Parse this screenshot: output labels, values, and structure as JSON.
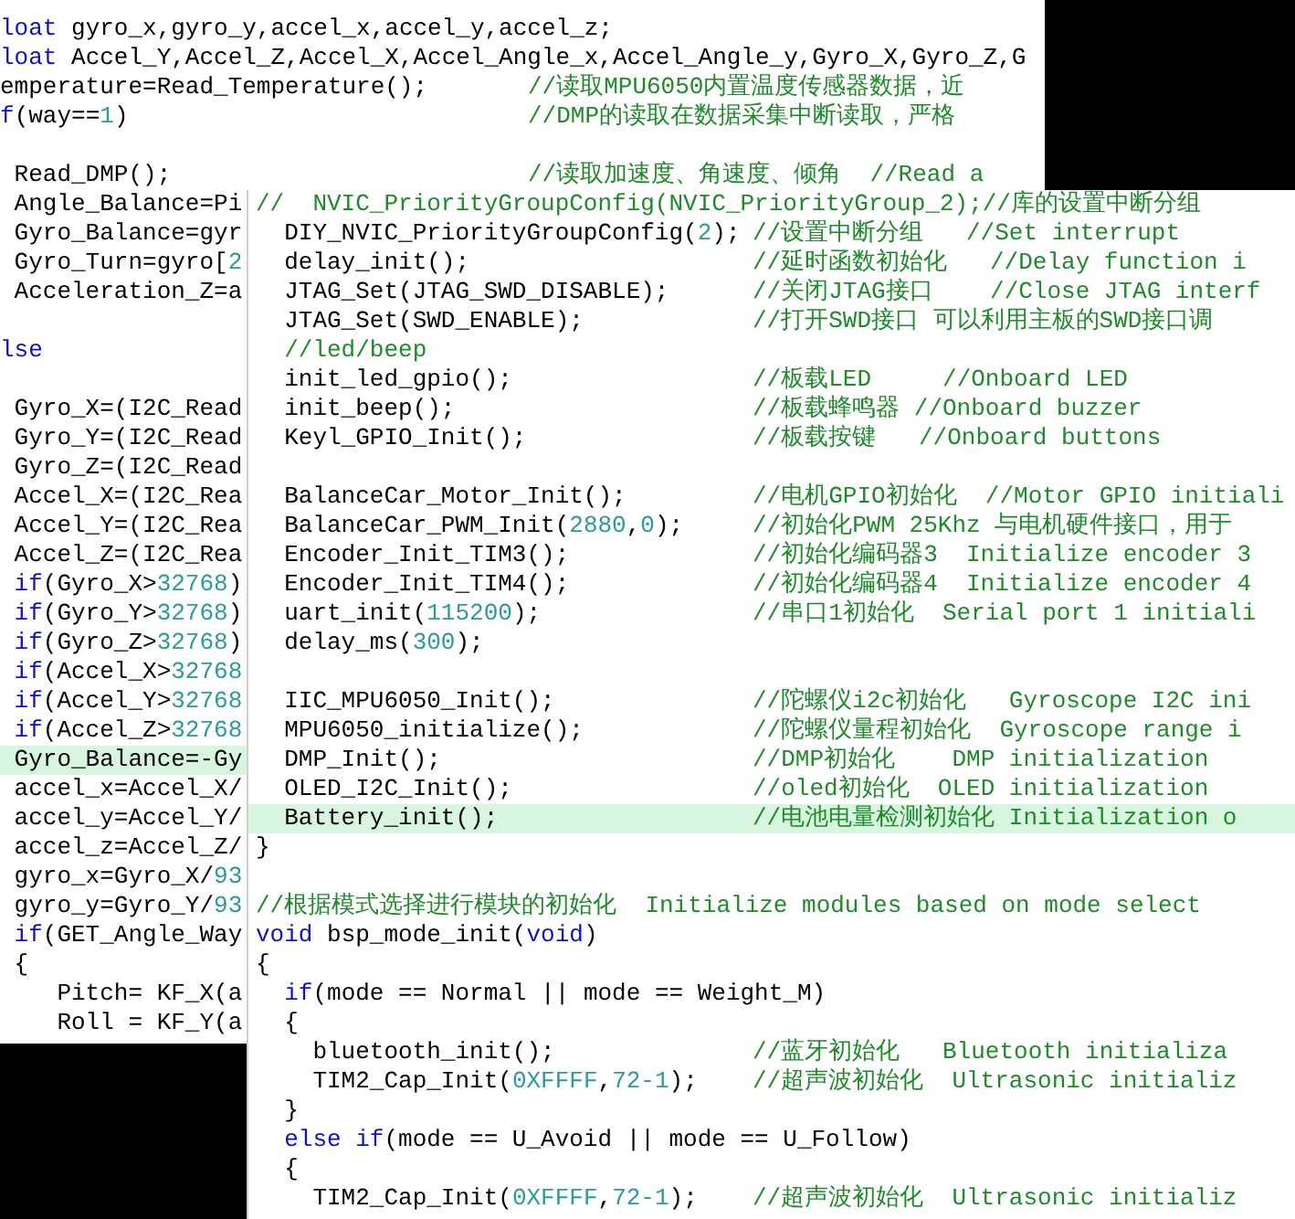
{
  "windows": [
    {
      "kind": "back",
      "lines": [
        {
          "code": [
            {
              "kind": "keyword",
              "text": "loat"
            },
            {
              "kind": "plain",
              "text": " gyro_x,gyro_y,accel_x,accel_y,accel_z;"
            }
          ]
        },
        {
          "code": [
            {
              "kind": "keyword",
              "text": "loat"
            },
            {
              "kind": "plain",
              "text": " Accel_Y,Accel_Z,Accel_X,Accel_Angle_x,Accel_Angle_y,Gyro_X,Gyro_Z,G"
            }
          ]
        },
        {
          "code": [
            {
              "kind": "plain",
              "text": "emperature=Read_Temperature();"
            }
          ],
          "comment": "//读取MPU6050内置温度传感器数据，近"
        },
        {
          "code": [
            {
              "kind": "keyword",
              "text": "f"
            },
            {
              "kind": "plain",
              "text": "(way=="
            },
            {
              "kind": "number",
              "text": "1"
            },
            {
              "kind": "plain",
              "text": ")"
            }
          ],
          "comment": "//DMP的读取在数据采集中断读取，严格"
        },
        {
          "gap_before": true,
          "code": [
            {
              "kind": "plain",
              "text": " Read_DMP();"
            }
          ],
          "comment": "//读取加速度、角速度、倾角  //Read a"
        },
        {
          "code": [
            {
              "kind": "plain",
              "text": " Angle_Balance=Pi"
            }
          ]
        },
        {
          "code": [
            {
              "kind": "plain",
              "text": " Gyro_Balance=gyr"
            }
          ]
        },
        {
          "code": [
            {
              "kind": "plain",
              "text": " Gyro_Turn=gyro["
            },
            {
              "kind": "number",
              "text": "2"
            }
          ]
        },
        {
          "code": [
            {
              "kind": "plain",
              "text": " Acceleration_Z=a"
            }
          ]
        },
        {
          "gap_before": true,
          "code": [
            {
              "kind": "keyword",
              "text": "lse"
            }
          ]
        },
        {
          "gap_before": true,
          "code": [
            {
              "kind": "plain",
              "text": " Gyro_X=(I2C_Read"
            }
          ]
        },
        {
          "code": [
            {
              "kind": "plain",
              "text": " Gyro_Y=(I2C_Read"
            }
          ]
        },
        {
          "code": [
            {
              "kind": "plain",
              "text": " Gyro_Z=(I2C_Read"
            }
          ]
        },
        {
          "code": [
            {
              "kind": "plain",
              "text": " Accel_X=(I2C_Rea"
            }
          ]
        },
        {
          "code": [
            {
              "kind": "plain",
              "text": " Accel_Y=(I2C_Rea"
            }
          ]
        },
        {
          "code": [
            {
              "kind": "plain",
              "text": " Accel_Z=(I2C_Rea"
            }
          ]
        },
        {
          "code": [
            {
              "kind": "keyword",
              "text": " if"
            },
            {
              "kind": "plain",
              "text": "(Gyro_X>"
            },
            {
              "kind": "number",
              "text": "32768"
            },
            {
              "kind": "plain",
              "text": ")"
            }
          ]
        },
        {
          "code": [
            {
              "kind": "keyword",
              "text": " if"
            },
            {
              "kind": "plain",
              "text": "(Gyro_Y>"
            },
            {
              "kind": "number",
              "text": "32768"
            },
            {
              "kind": "plain",
              "text": ")"
            }
          ]
        },
        {
          "code": [
            {
              "kind": "keyword",
              "text": " if"
            },
            {
              "kind": "plain",
              "text": "(Gyro_Z>"
            },
            {
              "kind": "number",
              "text": "32768"
            },
            {
              "kind": "plain",
              "text": ")"
            }
          ]
        },
        {
          "code": [
            {
              "kind": "keyword",
              "text": " if"
            },
            {
              "kind": "plain",
              "text": "(Accel_X>"
            },
            {
              "kind": "number",
              "text": "32768"
            }
          ]
        },
        {
          "code": [
            {
              "kind": "keyword",
              "text": " if"
            },
            {
              "kind": "plain",
              "text": "(Accel_Y>"
            },
            {
              "kind": "number",
              "text": "32768"
            }
          ]
        },
        {
          "code": [
            {
              "kind": "keyword",
              "text": " if"
            },
            {
              "kind": "plain",
              "text": "(Accel_Z>"
            },
            {
              "kind": "number",
              "text": "32768"
            }
          ]
        },
        {
          "code": [
            {
              "kind": "plain",
              "text": " Gyro_Balance=-Gy"
            }
          ],
          "highlighted": true
        },
        {
          "code": [
            {
              "kind": "plain",
              "text": " accel_x=Accel_X/"
            }
          ]
        },
        {
          "code": [
            {
              "kind": "plain",
              "text": " accel_y=Accel_Y/"
            }
          ]
        },
        {
          "code": [
            {
              "kind": "plain",
              "text": " accel_z=Accel_Z/"
            }
          ]
        },
        {
          "code": [
            {
              "kind": "plain",
              "text": " gyro_x=Gyro_X/"
            },
            {
              "kind": "number",
              "text": "93"
            }
          ]
        },
        {
          "code": [
            {
              "kind": "plain",
              "text": " gyro_y=Gyro_Y/"
            },
            {
              "kind": "number",
              "text": "93"
            }
          ]
        },
        {
          "code": [
            {
              "kind": "keyword",
              "text": " if"
            },
            {
              "kind": "plain",
              "text": "(GET_Angle_Way"
            }
          ]
        },
        {
          "code": [
            {
              "kind": "plain",
              "text": " {"
            }
          ]
        },
        {
          "code": [
            {
              "kind": "plain",
              "text": "    Pitch= KF_X(a"
            }
          ]
        },
        {
          "code": [
            {
              "kind": "plain",
              "text": "    Roll = KF_Y(a"
            }
          ]
        }
      ]
    },
    {
      "kind": "front",
      "lines": [
        {
          "code": [
            {
              "kind": "comment",
              "text": "//  NVIC_PriorityGroupConfig(NVIC_PriorityGroup_2);//库的设置中断分组"
            }
          ]
        },
        {
          "code": [
            {
              "kind": "plain",
              "text": "  DIY_NVIC_PriorityGroupConfig("
            },
            {
              "kind": "number",
              "text": "2"
            },
            {
              "kind": "plain",
              "text": ");"
            }
          ],
          "comment": "//设置中断分组   //Set interrupt"
        },
        {
          "code": [
            {
              "kind": "plain",
              "text": "  delay_init();"
            }
          ],
          "comment": "//延时函数初始化   //Delay function i"
        },
        {
          "code": [
            {
              "kind": "plain",
              "text": "  JTAG_Set(JTAG_SWD_DISABLE);"
            }
          ],
          "comment": "//关闭JTAG接口    //Close JTAG interf"
        },
        {
          "code": [
            {
              "kind": "plain",
              "text": "  JTAG_Set(SWD_ENABLE);"
            }
          ],
          "comment": "//打开SWD接口 可以利用主板的SWD接口调"
        },
        {
          "code": [
            {
              "kind": "comment",
              "text": "  //led/beep"
            }
          ]
        },
        {
          "code": [
            {
              "kind": "plain",
              "text": "  init_led_gpio();"
            }
          ],
          "comment": "//板载LED     //Onboard LED"
        },
        {
          "code": [
            {
              "kind": "plain",
              "text": "  init_beep();"
            }
          ],
          "comment": "//板载蜂鸣器 //Onboard buzzer"
        },
        {
          "code": [
            {
              "kind": "plain",
              "text": "  Keyl_GPIO_Init();"
            }
          ],
          "comment": "//板载按键   //Onboard buttons"
        },
        {
          "gap_before": true,
          "code": [
            {
              "kind": "plain",
              "text": "  BalanceCar_Motor_Init();"
            }
          ],
          "comment": "//电机GPIO初始化  //Motor GPIO initiali"
        },
        {
          "code": [
            {
              "kind": "plain",
              "text": "  BalanceCar_PWM_Init("
            },
            {
              "kind": "number",
              "text": "2880"
            },
            {
              "kind": "plain",
              "text": ","
            },
            {
              "kind": "number",
              "text": "0"
            },
            {
              "kind": "plain",
              "text": ");"
            }
          ],
          "comment": "//初始化PWM 25Khz 与电机硬件接口，用于"
        },
        {
          "code": [
            {
              "kind": "plain",
              "text": "  Encoder_Init_TIM3();"
            }
          ],
          "comment": "//初始化编码器3  Initialize encoder 3"
        },
        {
          "code": [
            {
              "kind": "plain",
              "text": "  Encoder_Init_TIM4();"
            }
          ],
          "comment": "//初始化编码器4  Initialize encoder 4"
        },
        {
          "code": [
            {
              "kind": "plain",
              "text": "  uart_init("
            },
            {
              "kind": "number",
              "text": "115200"
            },
            {
              "kind": "plain",
              "text": ");"
            }
          ],
          "comment": "//串口1初始化  Serial port 1 initiali"
        },
        {
          "code": [
            {
              "kind": "plain",
              "text": "  delay_ms("
            },
            {
              "kind": "number",
              "text": "300"
            },
            {
              "kind": "plain",
              "text": ");"
            }
          ]
        },
        {
          "gap_before": true,
          "code": [
            {
              "kind": "plain",
              "text": "  IIC_MPU6050_Init();"
            }
          ],
          "comment": "//陀螺仪i2c初始化   Gyroscope I2C ini"
        },
        {
          "code": [
            {
              "kind": "plain",
              "text": "  MPU6050_initialize();"
            }
          ],
          "comment": "//陀螺仪量程初始化  Gyroscope range i"
        },
        {
          "code": [
            {
              "kind": "plain",
              "text": "  DMP_Init();"
            }
          ],
          "comment": "//DMP初始化    DMP initialization"
        },
        {
          "code": [
            {
              "kind": "plain",
              "text": "  OLED_I2C_Init();"
            }
          ],
          "comment": "//oled初始化  OLED initialization"
        },
        {
          "code": [
            {
              "kind": "plain",
              "text": "  Battery_init();"
            }
          ],
          "comment": "//电池电量检测初始化 Initialization o",
          "highlighted": true
        },
        {
          "code": [
            {
              "kind": "plain",
              "text": "}"
            }
          ]
        },
        {
          "gap_before": true,
          "code": [
            {
              "kind": "comment",
              "text": "//根据模式选择进行模块的初始化  Initialize modules based on mode select"
            }
          ]
        },
        {
          "code": [
            {
              "kind": "keyword",
              "text": "void"
            },
            {
              "kind": "plain",
              "text": " bsp_mode_init("
            },
            {
              "kind": "keyword",
              "text": "void"
            },
            {
              "kind": "plain",
              "text": ")"
            }
          ]
        },
        {
          "code": [
            {
              "kind": "plain",
              "text": "{"
            }
          ]
        },
        {
          "code": [
            {
              "kind": "keyword",
              "text": "  if"
            },
            {
              "kind": "plain",
              "text": "(mode == Normal || mode == Weight_M)"
            }
          ]
        },
        {
          "code": [
            {
              "kind": "plain",
              "text": "  {"
            }
          ]
        },
        {
          "code": [
            {
              "kind": "plain",
              "text": "    bluetooth_init();"
            }
          ],
          "comment": "//蓝牙初始化   Bluetooth initializa"
        },
        {
          "code": [
            {
              "kind": "plain",
              "text": "    TIM2_Cap_Init("
            },
            {
              "kind": "number",
              "text": "0XFFFF"
            },
            {
              "kind": "plain",
              "text": ","
            },
            {
              "kind": "number",
              "text": "72-1"
            },
            {
              "kind": "plain",
              "text": ");"
            }
          ],
          "comment": "//超声波初始化  Ultrasonic initializ"
        },
        {
          "code": [
            {
              "kind": "plain",
              "text": "  }"
            }
          ]
        },
        {
          "code": [
            {
              "kind": "keyword",
              "text": "  else if"
            },
            {
              "kind": "plain",
              "text": "(mode == U_Avoid || mode == U_Follow)"
            }
          ]
        },
        {
          "code": [
            {
              "kind": "plain",
              "text": "  {"
            }
          ]
        },
        {
          "code": [
            {
              "kind": "plain",
              "text": "    TIM2_Cap_Init("
            },
            {
              "kind": "number",
              "text": "0XFFFF"
            },
            {
              "kind": "plain",
              "text": ","
            },
            {
              "kind": "number",
              "text": "72-1"
            },
            {
              "kind": "plain",
              "text": ");"
            }
          ],
          "comment": "//超声波初始化  Ultrasonic initializ"
        }
      ]
    }
  ]
}
